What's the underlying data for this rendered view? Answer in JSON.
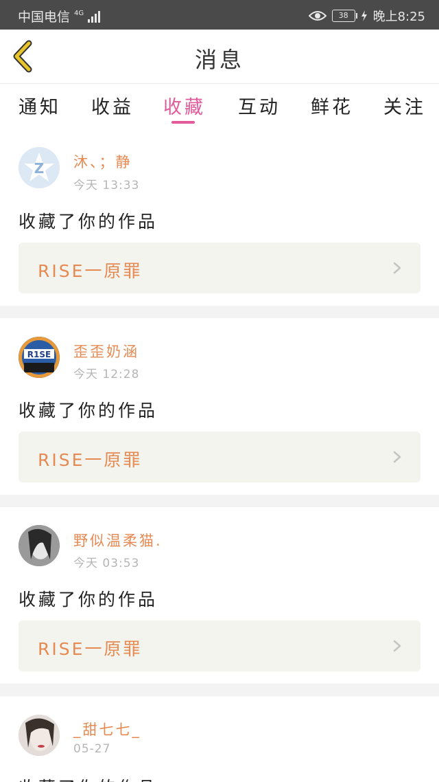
{
  "status_bar": {
    "carrier": "中国电信",
    "network": "4G",
    "battery": "38",
    "time": "晚上8:25"
  },
  "header": {
    "title": "消息"
  },
  "tabs": [
    {
      "label": "通知"
    },
    {
      "label": "收益"
    },
    {
      "label": "收藏",
      "active": true
    },
    {
      "label": "互动"
    },
    {
      "label": "鲜花"
    },
    {
      "label": "关注"
    }
  ],
  "items": [
    {
      "user": "沐、；静",
      "time": "今天 13:33",
      "action": "收藏了你的作品",
      "work": "RISE一原罪",
      "avatar_text": "Z"
    },
    {
      "user": "歪歪奶涵",
      "time": "今天 12:28",
      "action": "收藏了你的作品",
      "work": "RISE一原罪",
      "avatar_text": "R1SE"
    },
    {
      "user": "野似温柔猫.",
      "time": "今天 03:53",
      "action": "收藏了你的作品",
      "work": "RISE一原罪"
    },
    {
      "user": "_甜七七_",
      "time": "05-27",
      "action": "收藏了你的作品"
    }
  ],
  "colors": {
    "accent": "#e25a9a",
    "name": "#e58a53",
    "back": "#e7c42c"
  }
}
